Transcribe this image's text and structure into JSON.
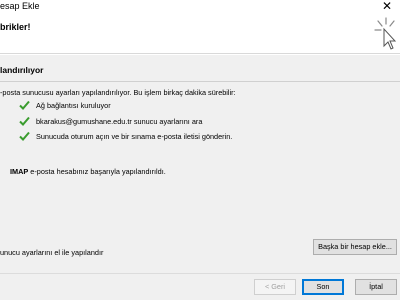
{
  "window": {
    "title": "esap Ekle",
    "close_glyph": "✕"
  },
  "header": {
    "heading": "brikler!",
    "icon": "wizard-sparkle-cursor-icon"
  },
  "section": {
    "title": "landırılıyor",
    "intro": "-posta sunucusu ayarları yapılandırılıyor. Bu işlem birkaç dakika sürebilir:"
  },
  "steps": [
    {
      "label": "Ağ bağlantısı kuruluyor",
      "status": "done"
    },
    {
      "label": "bkarakus@gumushane.edu.tr sunucu ayarlarını ara",
      "status": "done"
    },
    {
      "label": "Sunucuda oturum açın ve bir sınama e-posta iletisi gönderin.",
      "status": "done"
    }
  ],
  "result": {
    "protocol": "IMAP",
    "message": " e-posta hesabınız başarıyla yapılandırıldı."
  },
  "options": {
    "manual_label": "unucu ayarlarını el ile yapılandır",
    "another_account_button": "Başka bir hesap ekle..."
  },
  "footer": {
    "back_button": "< Geri",
    "finish_button": "Son",
    "cancel_button": "İptal"
  },
  "colors": {
    "check_green": "#3a9c2e",
    "accent_blue": "#0078d7"
  }
}
